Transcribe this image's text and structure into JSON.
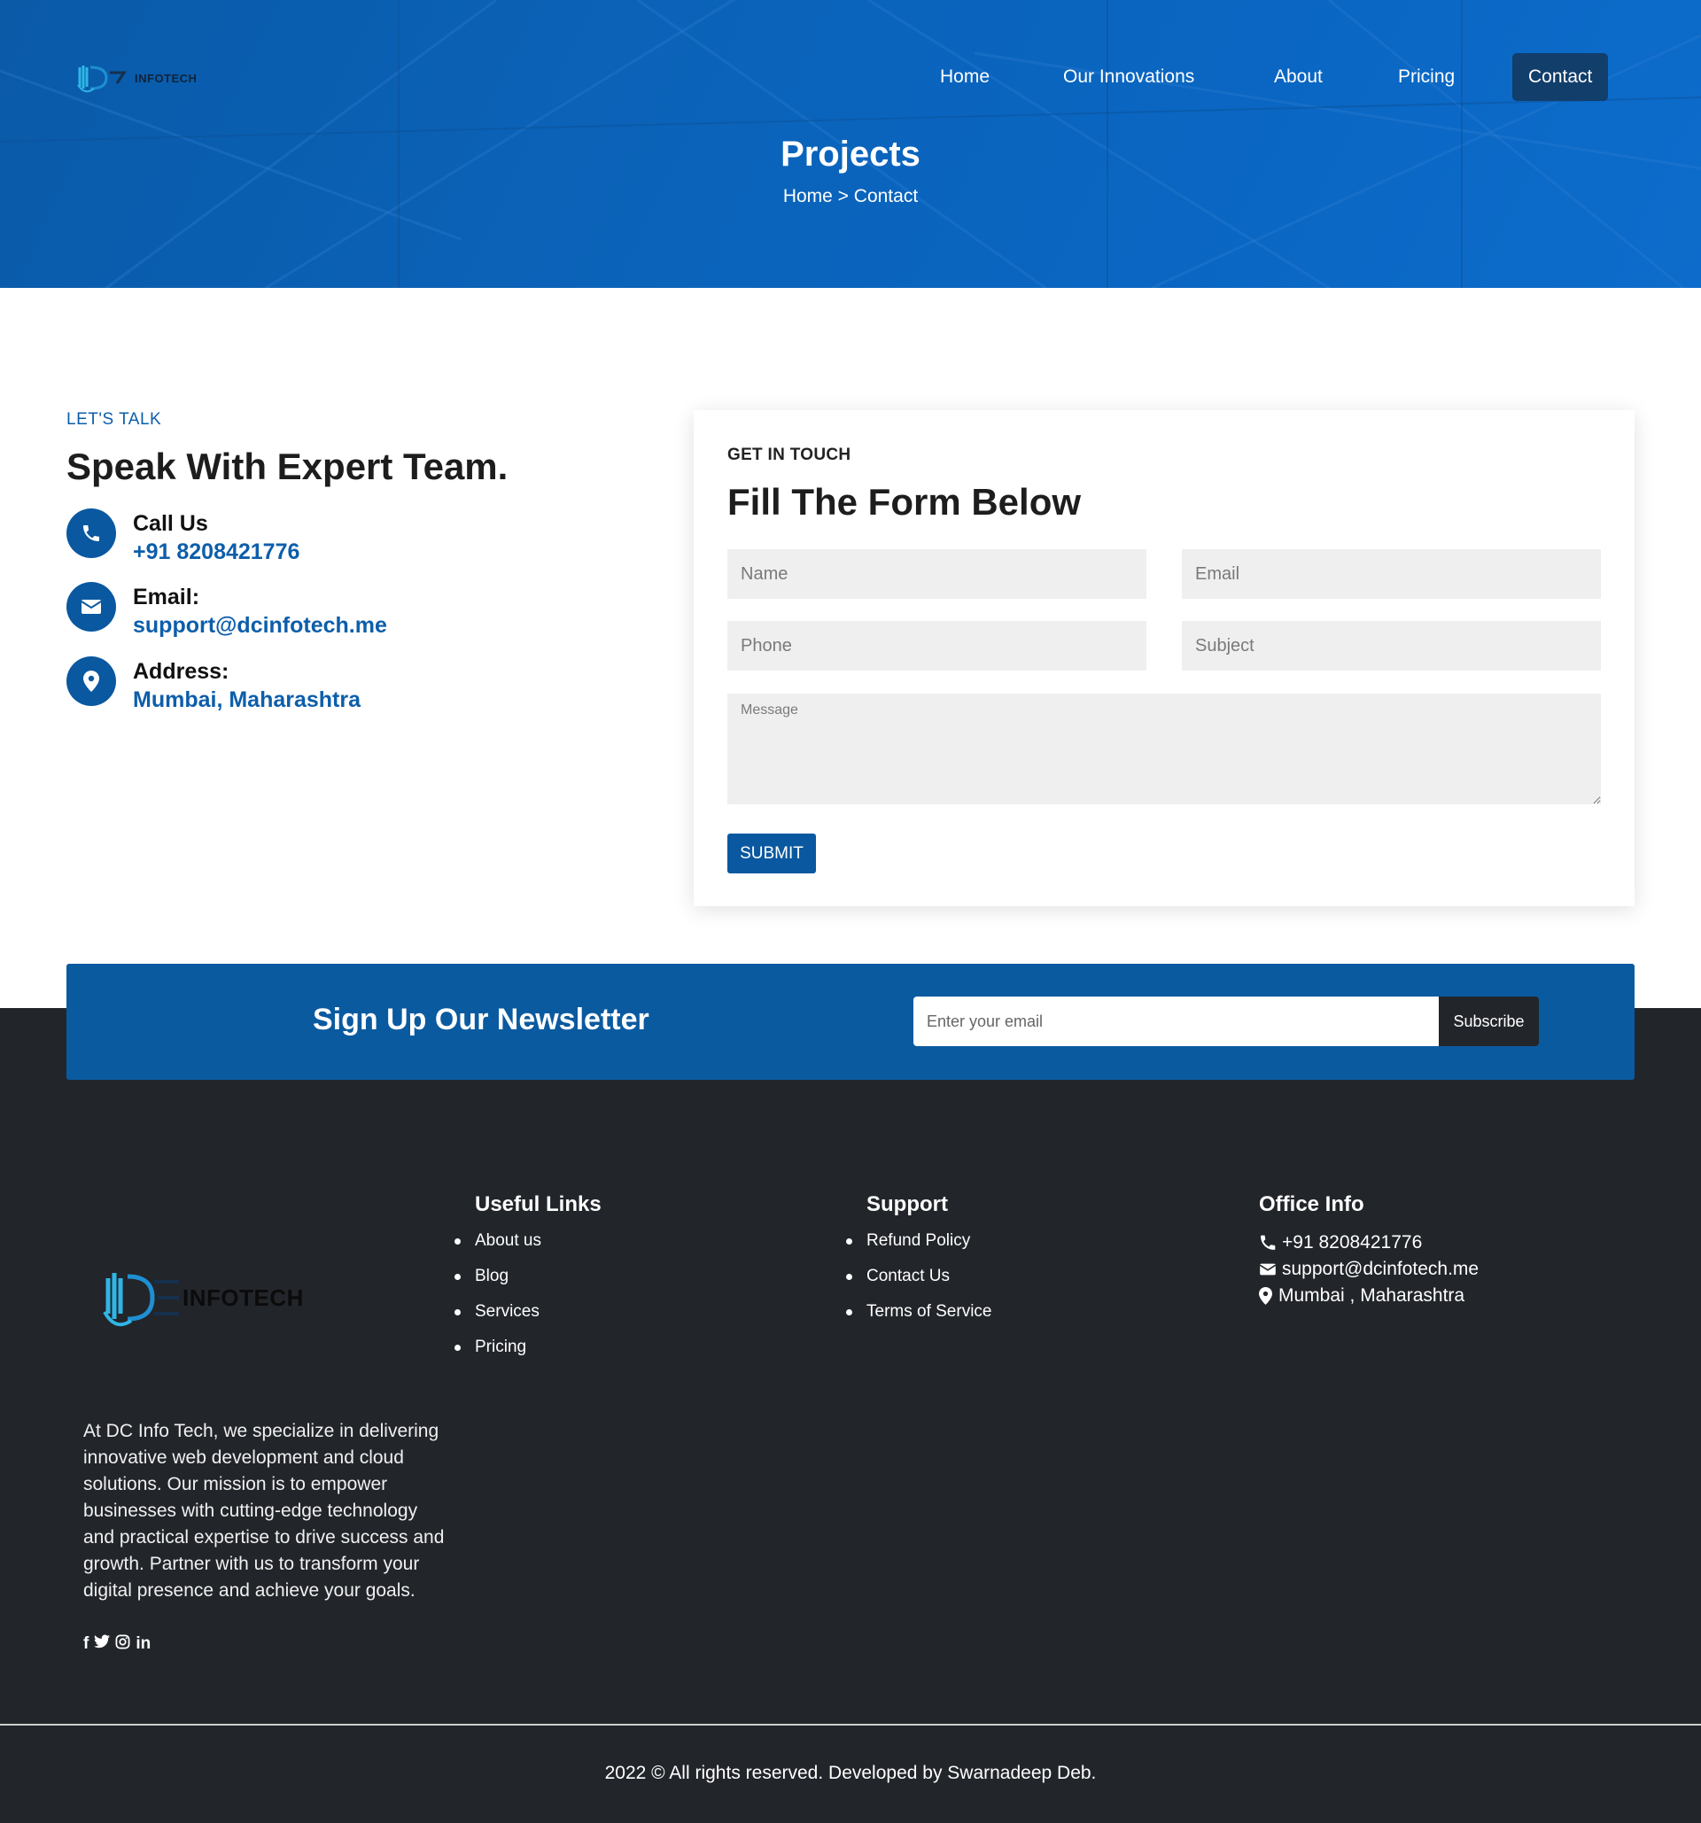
{
  "brand": {
    "name": "INFOTECH"
  },
  "nav": {
    "items": [
      {
        "label": "Home"
      },
      {
        "label": "Our Innovations"
      },
      {
        "label": "About"
      },
      {
        "label": "Pricing"
      },
      {
        "label": "Contact"
      }
    ]
  },
  "hero": {
    "title": "Projects",
    "breadcrumb": "Home > Contact"
  },
  "contact": {
    "eyebrow": "LET'S TALK",
    "heading": "Speak With Expert Team.",
    "items": [
      {
        "label": "Call Us",
        "value": "+91 8208421776",
        "icon": "phone-icon"
      },
      {
        "label": "Email:",
        "value": "support@dcinfotech.me",
        "icon": "envelope-icon"
      },
      {
        "label": "Address:",
        "value": "Mumbai, Maharashtra",
        "icon": "map-pin-icon"
      }
    ]
  },
  "form": {
    "eyebrow": "GET IN TOUCH",
    "heading": "Fill The Form Below",
    "name_placeholder": "Name",
    "email_placeholder": "Email",
    "phone_placeholder": "Phone",
    "subject_placeholder": "Subject",
    "message_placeholder": "Message",
    "submit_label": "SUBMIT"
  },
  "newsletter": {
    "title": "Sign Up Our Newsletter",
    "placeholder": "Enter your email",
    "button": "Subscribe"
  },
  "footer": {
    "about": "At DC Info Tech, we specialize in delivering innovative web development and cloud solutions. Our mission is to empower businesses with cutting-edge technology and practical expertise to drive success and growth. Partner with us to transform your digital presence and achieve your goals.",
    "social": [
      "facebook-icon",
      "twitter-icon",
      "instagram-icon",
      "linkedin-icon"
    ],
    "useful_links": {
      "title": "Useful Links",
      "items": [
        "About us",
        "Blog",
        "Services",
        "Pricing"
      ]
    },
    "support": {
      "title": "Support",
      "items": [
        "Refund Policy",
        "Contact Us",
        "Terms of Service"
      ]
    },
    "office": {
      "title": "Office Info",
      "phone": "+91 8208421776",
      "email": "support@dcinfotech.me",
      "address": "Mumbai , Maharashtra"
    },
    "copyright": "2022 © All rights reserved. Developed by Swarnadeep Deb."
  },
  "colors": {
    "primary": "#0a58a0",
    "hero": "#0b63b9",
    "footer": "#22252a",
    "nav_active": "#123e6b"
  }
}
